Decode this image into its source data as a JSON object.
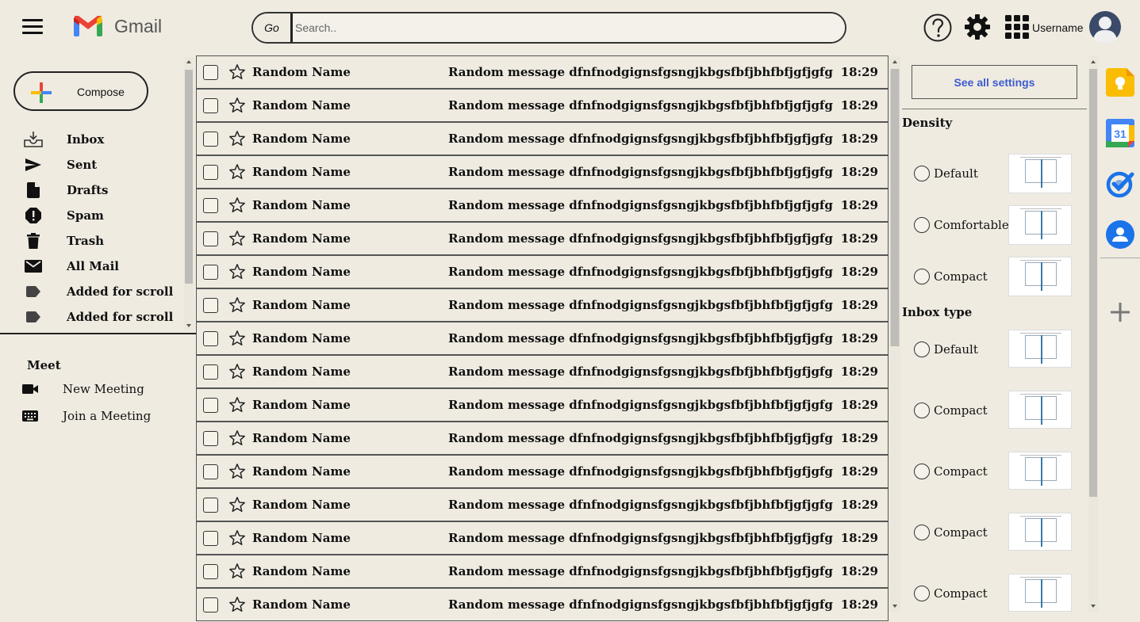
{
  "header": {
    "logo_text": "Gmail",
    "search_button": "Go",
    "search_placeholder": "Search..",
    "username": "Username"
  },
  "sidebar": {
    "compose_label": "Compose",
    "items": [
      {
        "label": "Inbox",
        "icon": "inbox-icon"
      },
      {
        "label": "Sent",
        "icon": "send-icon"
      },
      {
        "label": "Drafts",
        "icon": "draft-icon"
      },
      {
        "label": "Spam",
        "icon": "spam-icon"
      },
      {
        "label": "Trash",
        "icon": "trash-icon"
      },
      {
        "label": "All Mail",
        "icon": "mail-icon"
      },
      {
        "label": "Added for scroll",
        "icon": "label-icon"
      },
      {
        "label": "Added for scroll",
        "icon": "label-icon"
      }
    ],
    "meet": {
      "title": "Meet",
      "items": [
        {
          "label": "New Meeting",
          "icon": "video-camera-icon"
        },
        {
          "label": "Join a Meeting",
          "icon": "keyboard-icon"
        }
      ]
    }
  },
  "emails": [
    {
      "sender": "Random Name",
      "message": "Random message dfnfnodgignsfgsngjkbgsfbfjbhfbfjgfjgfg",
      "time": "18:29"
    },
    {
      "sender": "Random Name",
      "message": "Random message dfnfnodgignsfgsngjkbgsfbfjbhfbfjgfjgfg",
      "time": "18:29"
    },
    {
      "sender": "Random Name",
      "message": "Random message dfnfnodgignsfgsngjkbgsfbfjbhfbfjgfjgfg",
      "time": "18:29"
    },
    {
      "sender": "Random Name",
      "message": "Random message dfnfnodgignsfgsngjkbgsfbfjbhfbfjgfjgfg",
      "time": "18:29"
    },
    {
      "sender": "Random Name",
      "message": "Random message dfnfnodgignsfgsngjkbgsfbfjbhfbfjgfjgfg",
      "time": "18:29"
    },
    {
      "sender": "Random Name",
      "message": "Random message dfnfnodgignsfgsngjkbgsfbfjbhfbfjgfjgfg",
      "time": "18:29"
    },
    {
      "sender": "Random Name",
      "message": "Random message dfnfnodgignsfgsngjkbgsfbfjbhfbfjgfjgfg",
      "time": "18:29"
    },
    {
      "sender": "Random Name",
      "message": "Random message dfnfnodgignsfgsngjkbgsfbfjbhfbfjgfjgfg",
      "time": "18:29"
    },
    {
      "sender": "Random Name",
      "message": "Random message dfnfnodgignsfgsngjkbgsfbfjbhfbfjgfjgfg",
      "time": "18:29"
    },
    {
      "sender": "Random Name",
      "message": "Random message dfnfnodgignsfgsngjkbgsfbfjbhfbfjgfjgfg",
      "time": "18:29"
    },
    {
      "sender": "Random Name",
      "message": "Random message dfnfnodgignsfgsngjkbgsfbfjbhfbfjgfjgfg",
      "time": "18:29"
    },
    {
      "sender": "Random Name",
      "message": "Random message dfnfnodgignsfgsngjkbgsfbfjbhfbfjgfjgfg",
      "time": "18:29"
    },
    {
      "sender": "Random Name",
      "message": "Random message dfnfnodgignsfgsngjkbgsfbfjbhfbfjgfjgfg",
      "time": "18:29"
    },
    {
      "sender": "Random Name",
      "message": "Random message dfnfnodgignsfgsngjkbgsfbfjbhfbfjgfjgfg",
      "time": "18:29"
    },
    {
      "sender": "Random Name",
      "message": "Random message dfnfnodgignsfgsngjkbgsfbfjbhfbfjgfjgfg",
      "time": "18:29"
    },
    {
      "sender": "Random Name",
      "message": "Random message dfnfnodgignsfgsngjkbgsfbfjbhfbfjgfjgfg",
      "time": "18:29"
    },
    {
      "sender": "Random Name",
      "message": "Random message dfnfnodgignsfgsngjkbgsfbfjbhfbfjgfjgfg",
      "time": "18:29"
    }
  ],
  "settings": {
    "see_all_label": "See all settings",
    "density_title": "Density",
    "density_options": [
      "Default",
      "Comfortable",
      "Compact"
    ],
    "inbox_type_title": "Inbox type",
    "inbox_options": [
      "Default",
      "Compact",
      "Compact",
      "Compact",
      "Compact"
    ]
  },
  "side_apps": [
    "keep-icon",
    "calendar-icon",
    "tasks-icon",
    "contacts-icon",
    "add-icon"
  ],
  "calendar_day": "31",
  "colors": {
    "background": "#efebe1",
    "link_blue": "#3d5bd1",
    "keep_yellow": "#fbbc04",
    "google_blue": "#4285f4"
  }
}
